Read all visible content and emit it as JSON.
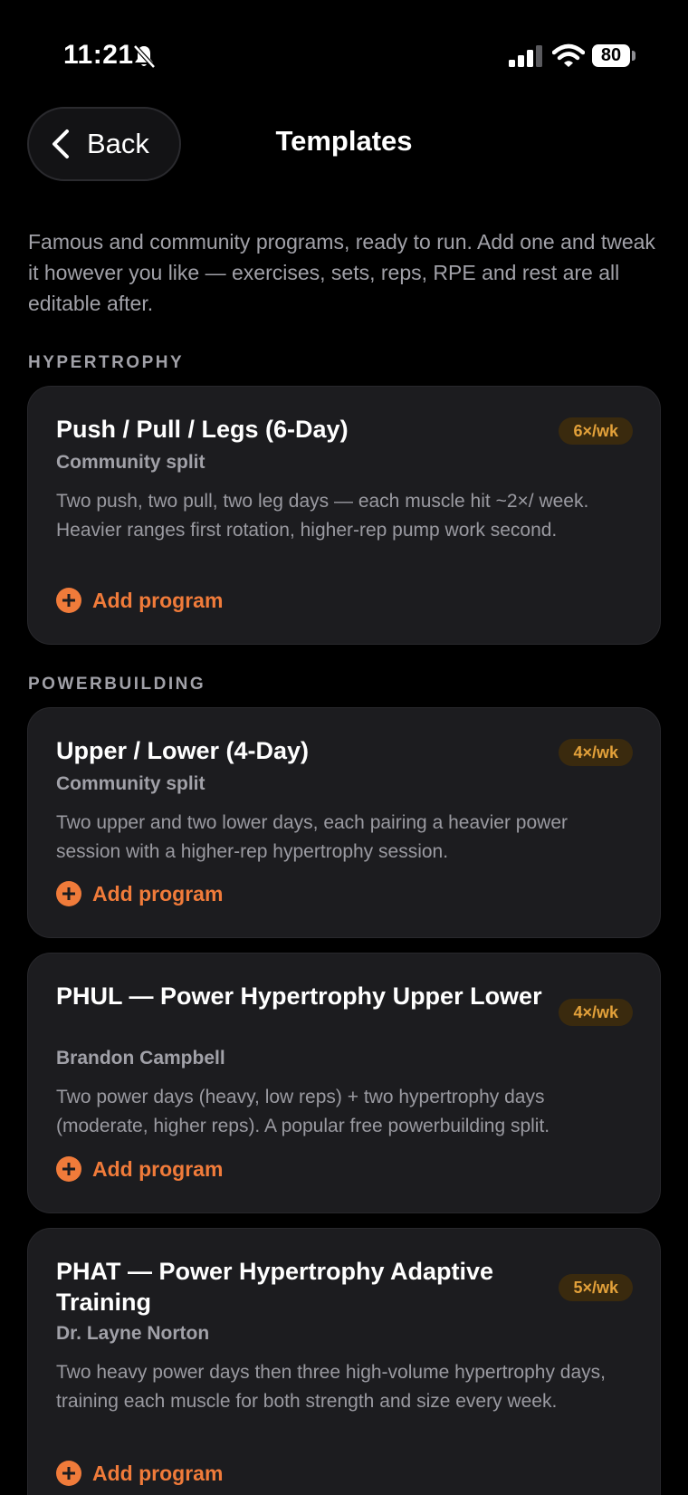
{
  "status_bar": {
    "time": "11:21",
    "battery": "80"
  },
  "nav": {
    "back_label": "Back",
    "title": "Templates"
  },
  "intro": "Famous and community programs, ready to run. Add one and tweak it however you like — exercises, sets, reps, RPE and rest are all editable after.",
  "sections": [
    {
      "label": "HYPERTROPHY",
      "cards": [
        {
          "title": "Push / Pull / Legs (6-Day)",
          "author": "Community split",
          "badge": "6×/wk",
          "description": "Two push, two pull, two leg days — each muscle hit ~2×/ week. Heavier ranges first rotation, higher-rep pump work second.",
          "add_label": "Add program"
        }
      ]
    },
    {
      "label": "POWERBUILDING",
      "cards": [
        {
          "title": "Upper / Lower (4-Day)",
          "author": "Community split",
          "badge": "4×/wk",
          "description": "Two upper and two lower days, each pairing a heavier power session with a higher-rep hypertrophy session.",
          "add_label": "Add program"
        },
        {
          "title": "PHUL — Power Hypertrophy Upper Lower",
          "author": "Brandon Campbell",
          "badge": "4×/wk",
          "description": "Two power days (heavy, low reps) + two hypertrophy days (moderate, higher reps). A popular free powerbuilding split.",
          "add_label": "Add program"
        },
        {
          "title": "PHAT — Power Hypertrophy Adaptive Training",
          "author": "Dr. Layne Norton",
          "badge": "5×/wk",
          "description": "Two heavy power days then three high-volume hypertrophy days, training each muscle for both strength and size every week.",
          "add_label": "Add program"
        }
      ]
    }
  ],
  "colors": {
    "background": "#000000",
    "card": "#1c1c1f",
    "accent": "#f07b3a",
    "badge_text": "#e3a13a",
    "badge_bg": "#3a2a0e",
    "muted_text": "#a1a1a8"
  },
  "icons": [
    "bell-slash-icon",
    "cellular-signal-icon",
    "wifi-icon",
    "battery-icon",
    "chevron-left-icon",
    "plus-circle-icon"
  ]
}
